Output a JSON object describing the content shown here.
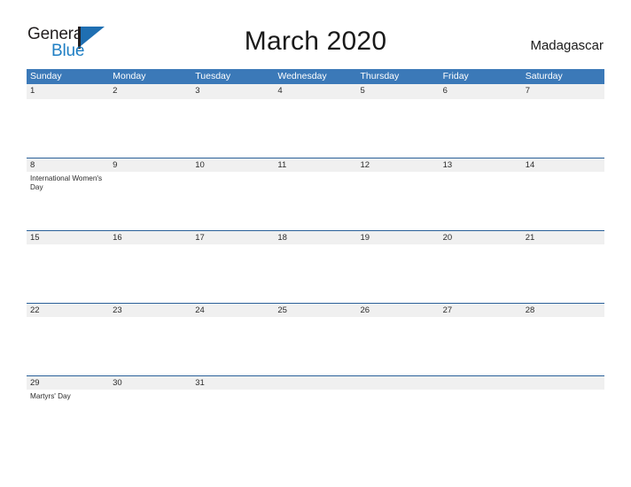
{
  "brand": {
    "word_one": "General",
    "word_two": "Blue",
    "flag_icon": "blue-flag-icon",
    "colors": {
      "dark": "#231f20",
      "blue": "#1f7fc4",
      "flag": "#1f6fb2"
    }
  },
  "header": {
    "title": "March 2020",
    "locale": "Madagascar"
  },
  "calendar": {
    "accent_color": "#3b79b8",
    "date_strip_color": "#f0f0f0",
    "rule_color": "#2a6099",
    "weekdays": [
      "Sunday",
      "Monday",
      "Tuesday",
      "Wednesday",
      "Thursday",
      "Friday",
      "Saturday"
    ],
    "weeks": [
      {
        "dates": [
          "1",
          "2",
          "3",
          "4",
          "5",
          "6",
          "7"
        ],
        "events": [
          "",
          "",
          "",
          "",
          "",
          "",
          ""
        ]
      },
      {
        "dates": [
          "8",
          "9",
          "10",
          "11",
          "12",
          "13",
          "14"
        ],
        "events": [
          "International Women's Day",
          "",
          "",
          "",
          "",
          "",
          ""
        ]
      },
      {
        "dates": [
          "15",
          "16",
          "17",
          "18",
          "19",
          "20",
          "21"
        ],
        "events": [
          "",
          "",
          "",
          "",
          "",
          "",
          ""
        ]
      },
      {
        "dates": [
          "22",
          "23",
          "24",
          "25",
          "26",
          "27",
          "28"
        ],
        "events": [
          "",
          "",
          "",
          "",
          "",
          "",
          ""
        ]
      },
      {
        "dates": [
          "29",
          "30",
          "31",
          "",
          "",
          "",
          ""
        ],
        "events": [
          "Martyrs' Day",
          "",
          "",
          "",
          "",
          "",
          ""
        ]
      }
    ]
  }
}
